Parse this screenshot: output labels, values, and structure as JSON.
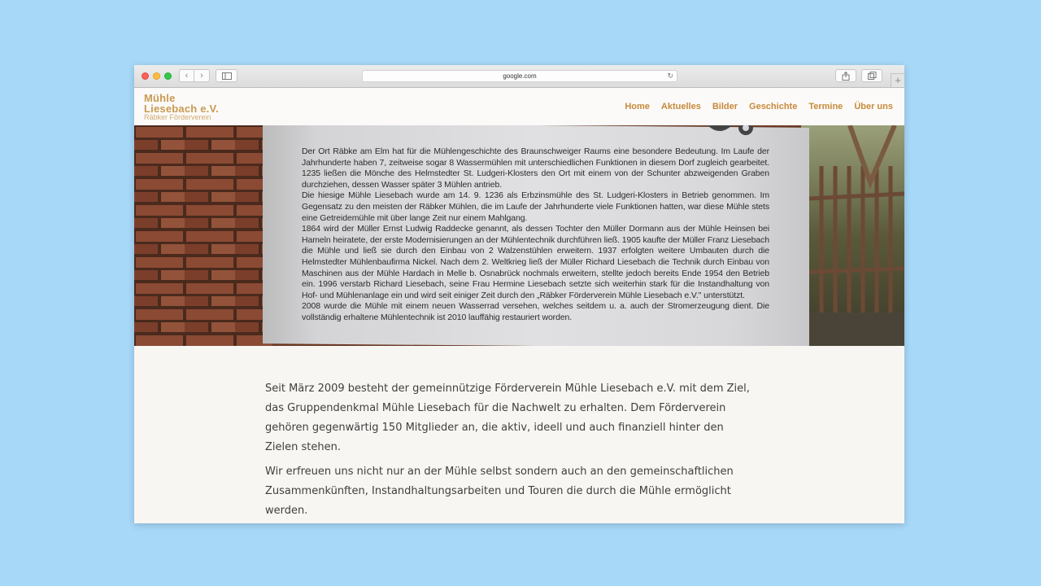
{
  "browser": {
    "url": "google.com",
    "icons": [
      "back-icon",
      "forward-icon",
      "sidebar-icon",
      "reload-icon",
      "share-icon",
      "tabs-icon",
      "new-tab-icon"
    ]
  },
  "site": {
    "logo": {
      "line1": "Mühle",
      "line2": "Liesebach e.V.",
      "sub": "Räbker Förderverein"
    },
    "nav": [
      "Home",
      "Aktuelles",
      "Bilder",
      "Geschichte",
      "Termine",
      "Über uns"
    ],
    "accent": "#c78a3a"
  },
  "hero": {
    "sign_paragraphs": [
      "Der Ort Räbke am Elm hat für die Mühlengeschichte des Braunschweiger Raums eine besondere Bedeutung. Im Laufe der Jahrhunderte haben 7, zeitweise sogar 8 Wassermühlen mit unterschiedlichen Funktionen in diesem Dorf zugleich gearbeitet. 1235 ließen die Mönche des Helmstedter St. Ludgeri-Klosters den Ort mit einem von der Schunter abzweigenden Graben durchziehen, dessen Wasser später 3 Mühlen antrieb.",
      "Die hiesige Mühle Liesebach wurde am 14. 9. 1236 als Erbzinsmühle des St. Ludgeri-Klosters in Betrieb genommen. Im Gegensatz zu den meisten der Räbker Mühlen, die im Laufe der Jahrhunderte viele Funktionen hatten, war diese Mühle stets eine Getreidemühle mit über lange Zeit nur einem Mahlgang.",
      "1864 wird der Müller Ernst Ludwig Raddecke genannt, als dessen Tochter den Müller Dormann aus der Mühle Heinsen bei Hameln heiratete, der erste Modernisierungen an der Mühlentechnik durchführen ließ. 1905 kaufte der Müller Franz Liesebach die Mühle und ließ sie durch den Einbau von 2 Walzenstühlen erweitern. 1937 erfolgten weitere Umbauten durch die Helmstedter Mühlenbaufirma Nickel. Nach dem 2. Weltkrieg ließ der Müller Richard Liesebach die Technik durch Einbau von Maschinen aus der Mühle Hardach in Melle b. Osnabrück nochmals erweitern, stellte jedoch bereits Ende 1954 den Betrieb ein. 1996 verstarb Richard Liesebach, seine Frau Hermine Liesebach setzte sich weiterhin stark für die Instandhaltung von Hof- und Mühlenanlage ein und wird seit einiger Zeit durch den „Räbker Förderverein Mühle Liesebach e.V.\" unterstützt.",
      "2008 wurde die Mühle mit einem neuen Wasserrad versehen, welches seitdem u. a. auch der Stromerzeugung dient. Die vollständig erhaltene Mühlentechnik ist 2010 lauffähig restauriert worden."
    ]
  },
  "content": {
    "paragraphs": [
      "Seit März 2009 besteht der gemeinnützige Förderverein Mühle Liesebach e.V. mit dem Ziel, das Gruppendenkmal Mühle Liesebach für die Nachwelt zu erhalten. Dem Förderverein gehören gegenwärtig 150 Mitglieder an, die aktiv, ideell und auch finanziell hinter den Zielen stehen.",
      "Wir erfreuen uns nicht nur an der Mühle selbst sondern auch an den gemeinschaftlichen Zusammenkünften, Instandhaltungsarbeiten und Touren die durch die Mühle ermöglicht werden."
    ]
  }
}
